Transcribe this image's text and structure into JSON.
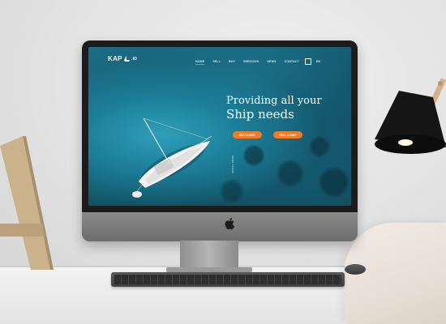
{
  "screen": {
    "logo": {
      "text_prefix": "KAP",
      "text_suffix": ".iD"
    },
    "nav": {
      "items": [
        {
          "label": "HOME",
          "active": true
        },
        {
          "label": "SELL",
          "active": false
        },
        {
          "label": "BUY",
          "active": false
        },
        {
          "label": "SERVICES",
          "active": false
        },
        {
          "label": "NEWS",
          "active": false
        },
        {
          "label": "CONTACT",
          "active": false
        }
      ],
      "language": "EN"
    },
    "hero": {
      "title_line1": "Providing all your",
      "title_line2": "Ship needs",
      "cta_primary": "BUY A SHIP",
      "cta_secondary": "SELL A SHIP",
      "scroll_hint": "SCROLL DOWN"
    }
  },
  "colors": {
    "accent": "#f07b28",
    "ocean": "#1b6c85",
    "hero_text": "#ffffff"
  },
  "icons": [
    "search-icon",
    "ship-logo-icon",
    "apple-logo-icon"
  ]
}
